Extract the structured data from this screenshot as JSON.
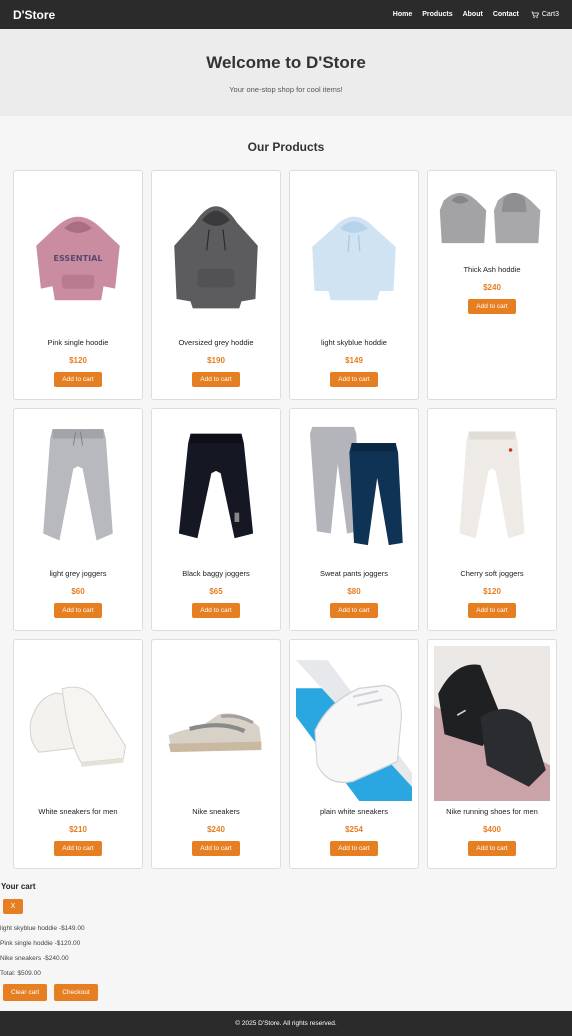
{
  "navbar": {
    "brand": "D'Store",
    "links": [
      "Home",
      "Products",
      "About",
      "Contact"
    ],
    "cart_label": "Cart3"
  },
  "hero": {
    "title": "Welcome to D'Store",
    "subtitle": "Your one-stop shop for cool items!"
  },
  "products": {
    "title": "Our Products",
    "button_label": "Add to cart",
    "items": [
      {
        "name": "Pink single hoodie",
        "price": "$120",
        "image": "pink-hoodie"
      },
      {
        "name": "Oversized grey hoddie",
        "price": "$190",
        "image": "grey-hoodie"
      },
      {
        "name": "light skyblue hoddie",
        "price": "$149",
        "image": "skyblue-hoodie"
      },
      {
        "name": "Thick Ash hoddie",
        "price": "$240",
        "image": "ash-hoodies"
      },
      {
        "name": "light grey joggers",
        "price": "$60",
        "image": "grey-joggers"
      },
      {
        "name": "Black baggy joggers",
        "price": "$65",
        "image": "black-joggers"
      },
      {
        "name": "Sweat pants joggers",
        "price": "$80",
        "image": "sweat-pants"
      },
      {
        "name": "Cherry soft joggers",
        "price": "$120",
        "image": "cream-joggers"
      },
      {
        "name": "White sneakers for men",
        "price": "$210",
        "image": "white-sneakers"
      },
      {
        "name": "Nike sneakers",
        "price": "$240",
        "image": "nike-sneakers"
      },
      {
        "name": "plain white sneakers",
        "price": "$254",
        "image": "plain-white-sneaker"
      },
      {
        "name": "Nike running shoes for men",
        "price": "$400",
        "image": "black-running-shoes"
      }
    ]
  },
  "cart": {
    "title": "Your cart",
    "close_label": "X",
    "items": [
      "light skyblue hoddie -$149.00",
      "Pink single hoddie -$120.00",
      "Nike sneakers -$240.00"
    ],
    "total": "Total: $509.00",
    "clear_label": "Clear cart",
    "checkout_label": "Checkout"
  },
  "footer": {
    "text": "© 2025 D'Store. All rights reserved."
  },
  "colors": {
    "accent": "#e67e22",
    "navbar": "#2b2b2b",
    "hero_bg": "#ececec"
  }
}
